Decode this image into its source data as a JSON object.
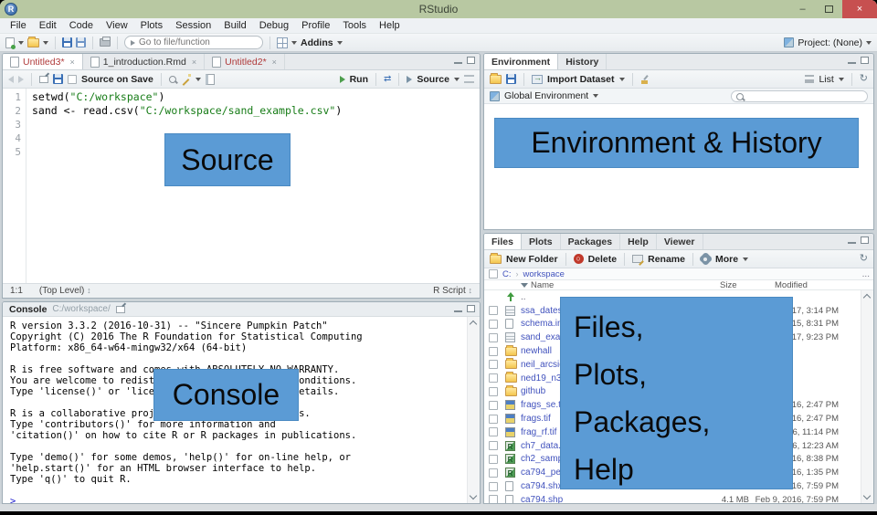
{
  "window": {
    "title": "RStudio"
  },
  "titlebar": {
    "minimize": "–",
    "close": "×"
  },
  "menu": {
    "items": [
      "File",
      "Edit",
      "Code",
      "View",
      "Plots",
      "Session",
      "Build",
      "Debug",
      "Profile",
      "Tools",
      "Help"
    ]
  },
  "toolbar": {
    "goto_placeholder": "Go to file/function",
    "addins_label": "Addins",
    "project_label": "Project: (None)"
  },
  "source_pane": {
    "tabs": [
      {
        "label": "Untitled3*",
        "kind": "r-script",
        "modified": true,
        "active": true
      },
      {
        "label": "1_introduction.Rmd",
        "kind": "rmd",
        "modified": false,
        "active": false
      },
      {
        "label": "Untitled2*",
        "kind": "r-script",
        "modified": true,
        "active": false
      }
    ],
    "toolbar": {
      "source_on_save": "Source on Save",
      "run_label": "Run",
      "source_label": "Source"
    },
    "code": [
      {
        "n": "1",
        "segments": [
          {
            "t": "setwd(",
            "c": "plain"
          },
          {
            "t": "\"C:/workspace\"",
            "c": "string"
          },
          {
            "t": ")",
            "c": "plain"
          }
        ]
      },
      {
        "n": "2",
        "segments": [
          {
            "t": "sand <- read.csv(",
            "c": "plain"
          },
          {
            "t": "\"C:/workspace/sand_example.csv\"",
            "c": "string"
          },
          {
            "t": ")",
            "c": "plain"
          }
        ]
      },
      {
        "n": "3",
        "segments": []
      },
      {
        "n": "4",
        "segments": []
      },
      {
        "n": "5",
        "segments": []
      }
    ],
    "status": {
      "position": "1:1",
      "scope": "(Top Level)",
      "type": "R Script"
    }
  },
  "console_pane": {
    "title": "Console",
    "path": "C:/workspace/",
    "lines": [
      "R version 3.3.2 (2016-10-31) -- \"Sincere Pumpkin Patch\"",
      "Copyright (C) 2016 The R Foundation for Statistical Computing",
      "Platform: x86_64-w64-mingw32/x64 (64-bit)",
      "",
      "R is free software and comes with ABSOLUTELY NO WARRANTY.",
      "You are welcome to redistribute it under certain conditions.",
      "Type 'license()' or 'licence()' for distribution details.",
      "",
      "R is a collaborative project with many contributors.",
      "Type 'contributors()' for more information and",
      "'citation()' on how to cite R or R packages in publications.",
      "",
      "Type 'demo()' for some demos, 'help()' for on-line help, or",
      "'help.start()' for an HTML browser interface to help.",
      "Type 'q()' to quit R.",
      ""
    ],
    "prompt": ">"
  },
  "environment_pane": {
    "tabs": {
      "labels": [
        "Environment",
        "History"
      ],
      "active": 0
    },
    "toolbar": {
      "import_label": "Import Dataset",
      "list_label": "List"
    },
    "scope_label": "Global Environment"
  },
  "files_pane": {
    "tabs": {
      "labels": [
        "Files",
        "Plots",
        "Packages",
        "Help",
        "Viewer"
      ],
      "active": 0
    },
    "toolbar": {
      "new_folder": "New Folder",
      "delete": "Delete",
      "rename": "Rename",
      "more": "More"
    },
    "breadcrumb": {
      "drive": "C:",
      "folder": "workspace",
      "ellipsis": "..."
    },
    "columns": {
      "name": "Name",
      "size": "Size",
      "modified": "Modified"
    },
    "rows": [
      {
        "icon": "up",
        "name": "..",
        "size": "",
        "modified": ""
      },
      {
        "icon": "spreadsheet",
        "name": "ssa_dates.csv",
        "size": "",
        "modified": "2017, 3:14 PM"
      },
      {
        "icon": "file",
        "name": "schema.ini",
        "size": "",
        "modified": "2015, 8:31 PM"
      },
      {
        "icon": "spreadsheet",
        "name": "sand_example",
        "size": "",
        "modified": "2017, 9:23 PM"
      },
      {
        "icon": "folder",
        "name": "newhall",
        "size": "",
        "modified": ""
      },
      {
        "icon": "folder",
        "name": "neil_arcsie",
        "size": "",
        "modified": ""
      },
      {
        "icon": "folder",
        "name": "ned19_n37x25",
        "size": "",
        "modified": ""
      },
      {
        "icon": "folder",
        "name": "github",
        "size": "",
        "modified": ""
      },
      {
        "icon": "tif",
        "name": "frags_se.tif",
        "size": "",
        "modified": "2016, 2:47 PM"
      },
      {
        "icon": "tif",
        "name": "frags.tif",
        "size": "",
        "modified": "2016, 2:47 PM"
      },
      {
        "icon": "tif",
        "name": "frag_rf.tif",
        "size": "",
        "modified": "2016, 11:14 PM"
      },
      {
        "icon": "rdata",
        "name": "ch7_data.Rdat",
        "size": "",
        "modified": "2016, 12:23 AM"
      },
      {
        "icon": "rdata",
        "name": "ch2_sample.R",
        "size": "",
        "modified": "2016, 8:38 PM"
      },
      {
        "icon": "rdata",
        "name": "ca794_pedons",
        "size": "",
        "modified": "2016, 1:35 PM"
      },
      {
        "icon": "file",
        "name": "ca794.shx",
        "size": "",
        "modified": "2016, 7:59 PM"
      },
      {
        "icon": "file",
        "name": "ca794.shp",
        "size": "4.1 MB",
        "modified": "Feb 9, 2016, 7:59 PM"
      }
    ]
  },
  "overlays": {
    "source": "Source",
    "environment": "Environment & History",
    "console": "Console",
    "files_lines": [
      "Files,",
      "Plots,",
      "Packages,",
      "Help"
    ]
  },
  "colors": {
    "overlay_blue": "#5b9bd5",
    "titlebar_green": "#b8c8a2",
    "close_red": "#c75050",
    "string_green": "#177c17",
    "link_blue": "#4152bd",
    "prompt_blue": "#2020cf"
  }
}
